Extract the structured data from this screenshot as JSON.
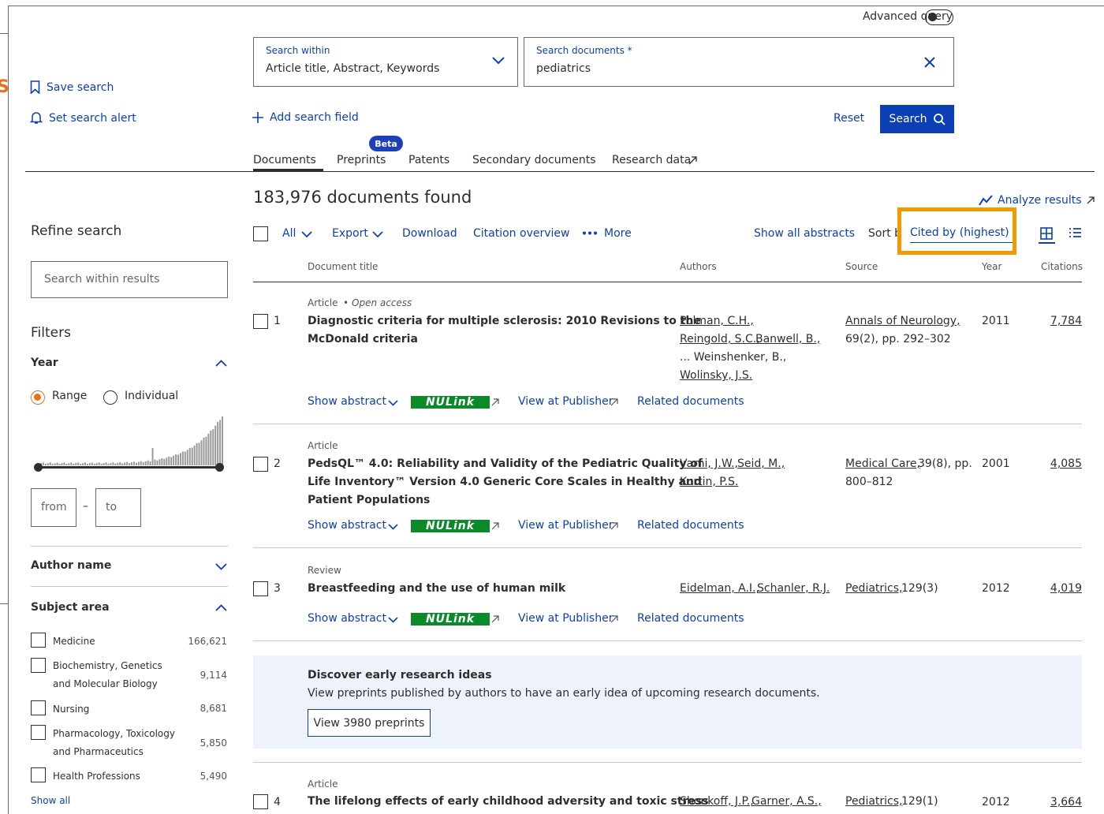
{
  "header": {
    "advanced_query": "Advanced query",
    "search_within_label": "Search within",
    "search_within_value": "Article title, Abstract, Keywords",
    "search_docs_label": "Search documents *",
    "search_docs_value": "pediatrics",
    "add_field": "Add search field",
    "reset": "Reset",
    "search": "Search"
  },
  "side_actions": {
    "save_search": "Save search",
    "set_alert": "Set search alert"
  },
  "tabs": [
    "Documents",
    "Preprints",
    "Patents",
    "Secondary documents",
    "Research data"
  ],
  "beta_badge": "Beta",
  "results": {
    "count_text": "183,976 documents found",
    "analyze": "Analyze results",
    "toolbar": {
      "all": "All",
      "export": "Export",
      "download": "Download",
      "citation_overview": "Citation overview",
      "more": "More",
      "show_abstracts": "Show all abstracts",
      "sort_label": "Sort by",
      "sort_value": "Cited by (highest)"
    },
    "columns": [
      "Document title",
      "Authors",
      "Source",
      "Year",
      "Citations"
    ],
    "docs": [
      {
        "num": "1",
        "type": "Article",
        "open_access": "Open access",
        "title_1": "Diagnostic criteria for multiple sclerosis: 2010 Revisions to the",
        "title_2": "McDonald criteria",
        "title_3": "",
        "authors_1": "Polman, C.H.,",
        "authors_2a": "Reingold, S.C.,",
        "authors_2b": "Banwell, B.,",
        "authors_3": "... Weinshenker, B.,",
        "authors_4": "Wolinsky, J.S.",
        "source_1": "Annals of Neurology,",
        "source_2": "69(2), pp. 292–302",
        "year": "2011",
        "citations": "7,784"
      },
      {
        "num": "2",
        "type": "Article",
        "title_1": "PedsQL™ 4.0: Reliability and Validity of the Pediatric Quality of",
        "title_2": "Life Inventory™ Version 4.0 Generic Core Scales in Healthy and",
        "title_3": "Patient Populations",
        "authors_1a": "Varni, J.W.,",
        "authors_1b": "Seid, M.,",
        "authors_2": "Kurtin, P.S.",
        "source_1a": "Medical Care,",
        "source_1b": "39(8), pp.",
        "source_2": "800–812",
        "year": "2001",
        "citations": "4,085"
      },
      {
        "num": "3",
        "type": "Review",
        "title_1": "Breastfeeding and the use of human milk",
        "authors_1a": "Eidelman, A.I.,",
        "authors_1b": "Schanler, R.J.",
        "source_1a": "Pediatrics,",
        "source_1b": "129(3)",
        "year": "2012",
        "citations": "4,019"
      },
      {
        "num": "4",
        "type": "Article",
        "title_1": "The lifelong effects of early childhood adversity and toxic stress",
        "authors_1a": "Shonkoff, J.P.,",
        "authors_1b": "Garner, A.S.,",
        "source_1a": "Pediatrics,",
        "source_1b": "129(1)",
        "year": "2012",
        "citations": "3,664"
      }
    ],
    "actions": {
      "show_abstract": "Show abstract",
      "nulink": "NULink",
      "view_publisher": "View at Publisher",
      "related": "Related documents"
    }
  },
  "promo": {
    "title": "Discover early research ideas",
    "text": "View preprints published by authors to have an early idea of upcoming research documents.",
    "button": "View 3980 preprints"
  },
  "refine": {
    "title": "Refine search",
    "search_placeholder": "Search within results",
    "filters": "Filters",
    "year": "Year",
    "range": "Range",
    "individual": "Individual",
    "from": "from",
    "dash": "–",
    "to": "to",
    "author_name": "Author name",
    "subject_area": "Subject area",
    "subjects": [
      {
        "l1": "Medicine",
        "l2": "",
        "count": "166,621"
      },
      {
        "l1": "Biochemistry, Genetics",
        "l2": "and Molecular Biology",
        "count": "9,114"
      },
      {
        "l1": "Nursing",
        "l2": "",
        "count": "8,681"
      },
      {
        "l1": "Pharmacology, Toxicology",
        "l2": "and Pharmaceutics",
        "count": "5,850"
      },
      {
        "l1": "Health Professions",
        "l2": "",
        "count": "5,490"
      }
    ],
    "show_all": "Show all"
  },
  "colors": {
    "primary": "#0c3fb5",
    "highlight": "#f29b00",
    "accent": "#e9711c",
    "nulink": "#0b8a2a"
  }
}
